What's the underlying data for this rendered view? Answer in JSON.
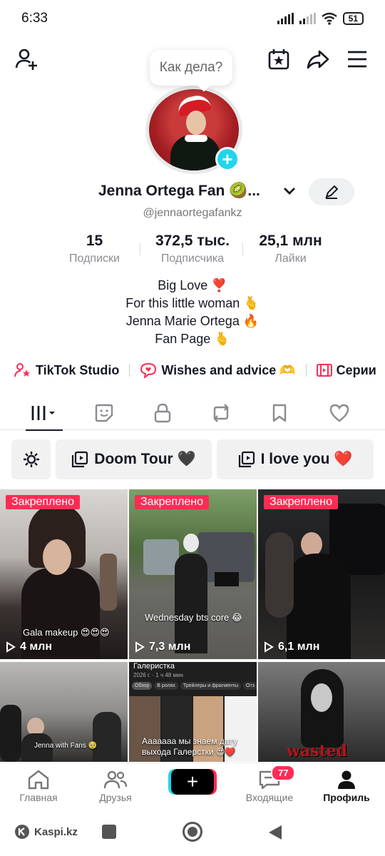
{
  "status": {
    "time": "6:33",
    "battery": "51"
  },
  "bubble": {
    "text": "Как дела?"
  },
  "profile": {
    "display_name": "Jenna Ortega Fan 🥝...",
    "username": "@jennaortegafankz"
  },
  "stats": [
    {
      "value": "15",
      "label": "Подписки"
    },
    {
      "value": "372,5 тыс.",
      "label": "Подписчика"
    },
    {
      "value": "25,1 млн",
      "label": "Лайки"
    }
  ],
  "bio": {
    "line1": "Big Love ❣️",
    "line2": "For this little woman 🫰",
    "line3": "Jenna Marie Ortega 🔥",
    "line4": "Fan Page 🫰"
  },
  "links": {
    "studio": "TikTok Studio",
    "wishes": "Wishes and advice 🫶",
    "series": "Серии"
  },
  "playlists": {
    "p1": "Doom Tour 🖤",
    "p2": "I love you ❤️"
  },
  "videos": [
    {
      "pinned": "Закреплено",
      "views": "4 млн",
      "caption": "Gala makeup 😍😍😍"
    },
    {
      "pinned": "Закреплено",
      "views": "7,3 млн",
      "caption": "Wednesday bts core 😂"
    },
    {
      "pinned": "Закреплено",
      "views": "6,1 млн",
      "caption": ""
    },
    {
      "caption": "Jenna with Fans 🥹"
    },
    {
      "header": "Галеристка",
      "sub": "2026 г. · 1 ч 48 мин",
      "chips": [
        "Обзор",
        "В ролях",
        "Трейлеры и фрагменты",
        "Отз"
      ],
      "caption": "Ааааааа мы знаем дату выхода Галерстки 😍❤️"
    },
    {
      "caption": "wasted"
    }
  ],
  "nav": {
    "home": "Главная",
    "friends": "Друзья",
    "inbox": "Входящие",
    "inbox_badge": "77",
    "profile": "Профиль"
  },
  "system": {
    "kaspi": "Kaspi.kz"
  },
  "colors": {
    "accent": "#fe2c55",
    "cyan": "#20d5ec"
  }
}
